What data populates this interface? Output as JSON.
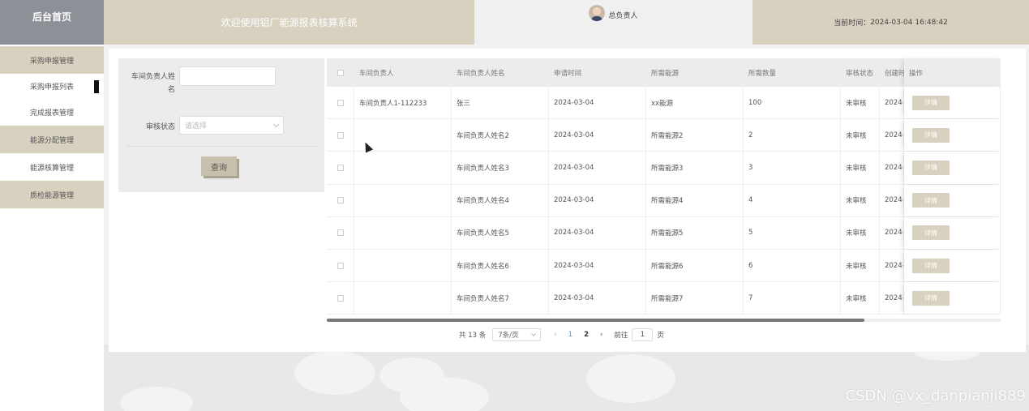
{
  "sidebar": {
    "logo": "后台首页",
    "items": [
      {
        "label": "采购申报管理",
        "style": "tan"
      },
      {
        "label": "采购申报列表",
        "style": "sub-active"
      },
      {
        "label": "完成报表管理",
        "style": "white"
      },
      {
        "label": "能源分配管理",
        "style": "tan"
      },
      {
        "label": "能源核算管理",
        "style": "white"
      },
      {
        "label": "质检能源管理",
        "style": "tan"
      }
    ]
  },
  "header": {
    "title": "欢迎使用铝厂能源报表核算系统",
    "user": "总负责人",
    "time_label": "当前时间：",
    "time_value": "2024-03-04 16:48:42"
  },
  "search": {
    "manager_name_label": "车间负责人姓名",
    "manager_name_value": "",
    "status_label": "审核状态",
    "status_placeholder": "请选择",
    "query_button": "查询"
  },
  "table": {
    "headers": [
      "",
      "车间负责人",
      "车间负责人姓名",
      "申请时间",
      "所需能源",
      "所需数量",
      "审核状态",
      "创建时",
      "操作"
    ],
    "rows": [
      {
        "manager": "车间负责人1-112233",
        "name": "张三",
        "date": "2024-03-04",
        "energy": "xx能源",
        "qty": "100",
        "status": "未审核",
        "created": "2024-0"
      },
      {
        "manager": "",
        "name": "车间负责人姓名2",
        "date": "2024-03-04",
        "energy": "所需能源2",
        "qty": "2",
        "status": "未审核",
        "created": "2024-0"
      },
      {
        "manager": "",
        "name": "车间负责人姓名3",
        "date": "2024-03-04",
        "energy": "所需能源3",
        "qty": "3",
        "status": "未审核",
        "created": "2024-0"
      },
      {
        "manager": "",
        "name": "车间负责人姓名4",
        "date": "2024-03-04",
        "energy": "所需能源4",
        "qty": "4",
        "status": "未审核",
        "created": "2024-0"
      },
      {
        "manager": "",
        "name": "车间负责人姓名5",
        "date": "2024-03-04",
        "energy": "所需能源5",
        "qty": "5",
        "status": "未审核",
        "created": "2024-0"
      },
      {
        "manager": "",
        "name": "车间负责人姓名6",
        "date": "2024-03-04",
        "energy": "所需能源6",
        "qty": "6",
        "status": "未审核",
        "created": "2024-0"
      },
      {
        "manager": "",
        "name": "车间负责人姓名7",
        "date": "2024-03-04",
        "energy": "所需能源7",
        "qty": "7",
        "status": "未审核",
        "created": "2024-0"
      }
    ],
    "detail_button": "详情"
  },
  "pagination": {
    "total": "共 13 条",
    "page_size": "7条/页",
    "prev": "‹",
    "pages": [
      "1",
      "2"
    ],
    "next": "›",
    "goto_label": "前往",
    "goto_value": "1",
    "goto_suffix": "页"
  },
  "watermark": "CSDN @vx_danpianji889",
  "colors": {
    "sidebar_header": "#8e9098",
    "accent_tan": "#d8d1c0",
    "pager_active": "#409eff"
  }
}
